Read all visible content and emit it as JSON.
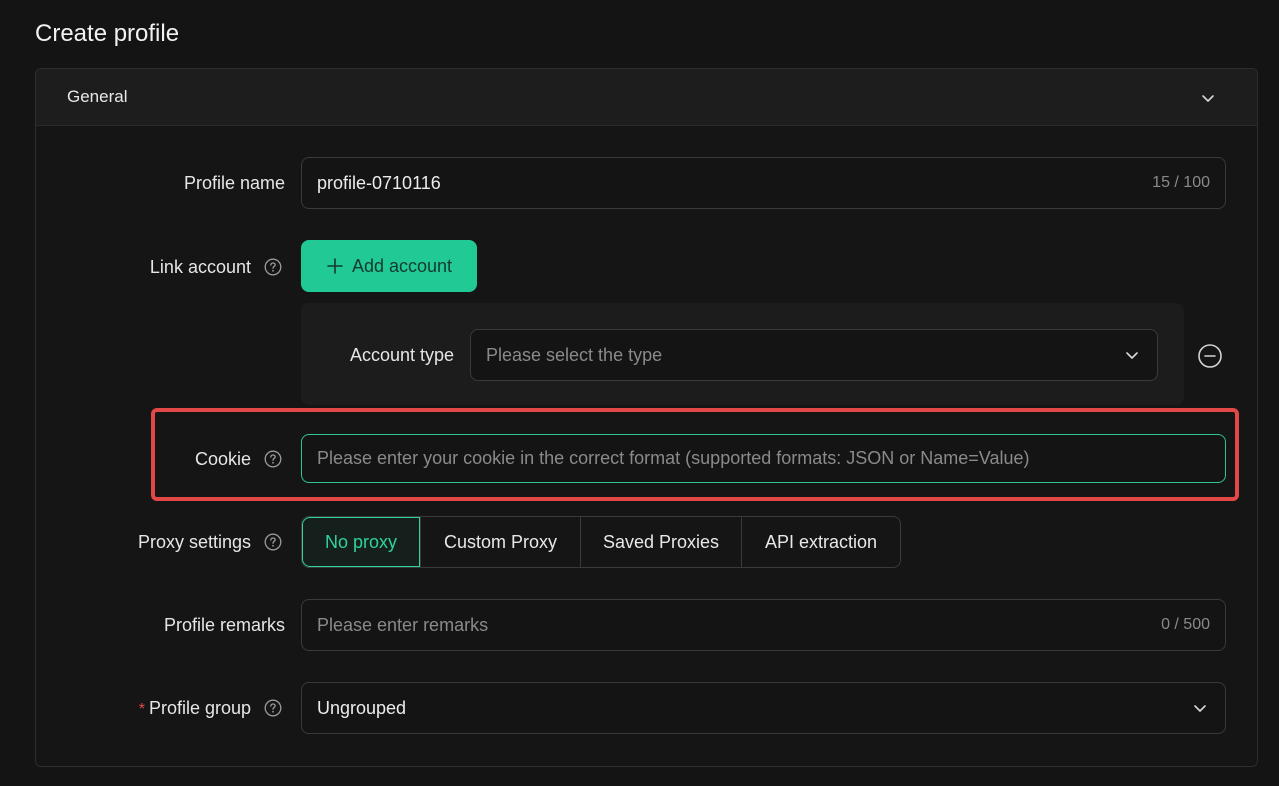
{
  "page": {
    "title": "Create profile"
  },
  "section": {
    "title": "General"
  },
  "profile_name": {
    "label": "Profile name",
    "value": "profile-0710116",
    "counter": "15 / 100"
  },
  "link_account": {
    "label": "Link account",
    "add_button": "Add account",
    "account_type_label": "Account type",
    "account_type_placeholder": "Please select the type"
  },
  "cookie": {
    "label": "Cookie",
    "placeholder": "Please enter your cookie in the correct format (supported formats: JSON or Name=Value)"
  },
  "proxy": {
    "label": "Proxy settings",
    "options": [
      "No proxy",
      "Custom Proxy",
      "Saved Proxies",
      "API extraction"
    ],
    "selected": "No proxy"
  },
  "remarks": {
    "label": "Profile remarks",
    "placeholder": "Please enter remarks",
    "counter": "0 / 500"
  },
  "group": {
    "required_mark": "*",
    "label": "Profile group",
    "value": "Ungrouped"
  },
  "colors": {
    "accent": "#21c995",
    "highlight": "#e24848",
    "background": "#141414"
  },
  "icons": {
    "help": "question-circle-icon",
    "chevron": "chevron-down-icon",
    "plus": "plus-icon",
    "remove": "minus-circle-icon"
  }
}
